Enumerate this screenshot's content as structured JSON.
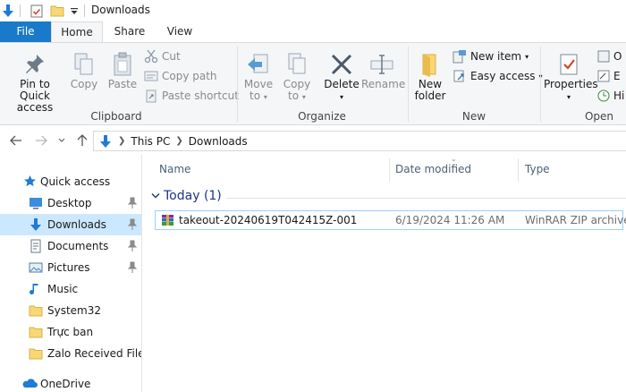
{
  "window": {
    "title": "Downloads"
  },
  "ribbon_tabs": [
    {
      "label": "File"
    },
    {
      "label": "Home"
    },
    {
      "label": "Share"
    },
    {
      "label": "View"
    }
  ],
  "clipboard": {
    "label": "Clipboard",
    "pin_line1": "Pin to Quick",
    "pin_line2": "access",
    "copy": "Copy",
    "paste": "Paste",
    "cut": "Cut",
    "copy_path": "Copy path",
    "paste_shortcut": "Paste shortcut"
  },
  "organize": {
    "label": "Organize",
    "move_to_line1": "Move",
    "move_to_line2": "to",
    "copy_to_line1": "Copy",
    "copy_to_line2": "to",
    "delete": "Delete",
    "rename": "Rename"
  },
  "new_group": {
    "label": "New",
    "new_folder_line1": "New",
    "new_folder_line2": "folder",
    "new_item": "New item",
    "easy_access": "Easy access"
  },
  "open_group": {
    "label": "Open",
    "properties": "Properties",
    "open_partial": "O",
    "edit_partial": "E",
    "history_partial": "Hi"
  },
  "address": {
    "crumbs": [
      "This PC",
      "Downloads"
    ]
  },
  "nav_pane": {
    "quick_access": "Quick access",
    "items": [
      {
        "label": "Desktop",
        "pinned": true
      },
      {
        "label": "Downloads",
        "pinned": true,
        "selected": true
      },
      {
        "label": "Documents",
        "pinned": true
      },
      {
        "label": "Pictures",
        "pinned": true
      },
      {
        "label": "Music"
      },
      {
        "label": "System32"
      },
      {
        "label": "Trực ban"
      },
      {
        "label": "Zalo Received Files"
      }
    ],
    "onedrive": "OneDrive"
  },
  "file_list": {
    "columns": [
      "Name",
      "Date modified",
      "Type"
    ],
    "group_header": "Today (1)",
    "rows": [
      {
        "name": "takeout-20240619T042415Z-001",
        "date": "6/19/2024 11:26 AM",
        "type": "WinRAR ZIP archive"
      }
    ]
  },
  "colors": {
    "file_tab": "#1979ca",
    "selection": "#cce8ff",
    "group_header": "#1e3287",
    "accent_blue": "#1e7bd6"
  }
}
